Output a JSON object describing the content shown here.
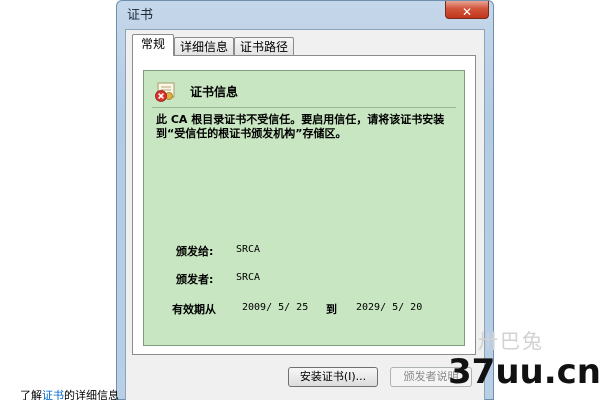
{
  "window": {
    "title": "证书",
    "close_glyph": "✕"
  },
  "tabs": [
    {
      "label": "常规",
      "active": true
    },
    {
      "label": "详细信息",
      "active": false
    },
    {
      "label": "证书路径",
      "active": false
    }
  ],
  "info": {
    "title": "证书信息",
    "icon": "certificate-error-icon",
    "warning": "此 CA 根目录证书不受信任。要启用信任，请将该证书安装到“受信任的根证书颁发机构”存储区。",
    "issued_to_label": "颁发给:",
    "issued_to_value": "SRCA",
    "issued_by_label": "颁发者:",
    "issued_by_value": "SRCA",
    "valid_from_label": "有效期从",
    "valid_from_value": "2009/ 5/ 25",
    "valid_to_label": "到",
    "valid_to_value": "2029/ 5/ 20"
  },
  "buttons": {
    "install": "安装证书(I)...",
    "issuer_statement": "颁发者说明"
  },
  "link_row": {
    "prefix": "了解",
    "link": "证书",
    "suffix": "的详细信息"
  },
  "watermark": {
    "logo": "37uu.cn",
    "faint": "卅巴兔"
  },
  "colors": {
    "info_box_bg": "#c8e6c1",
    "close_button": "#c0371c",
    "link": "#0066cc"
  }
}
